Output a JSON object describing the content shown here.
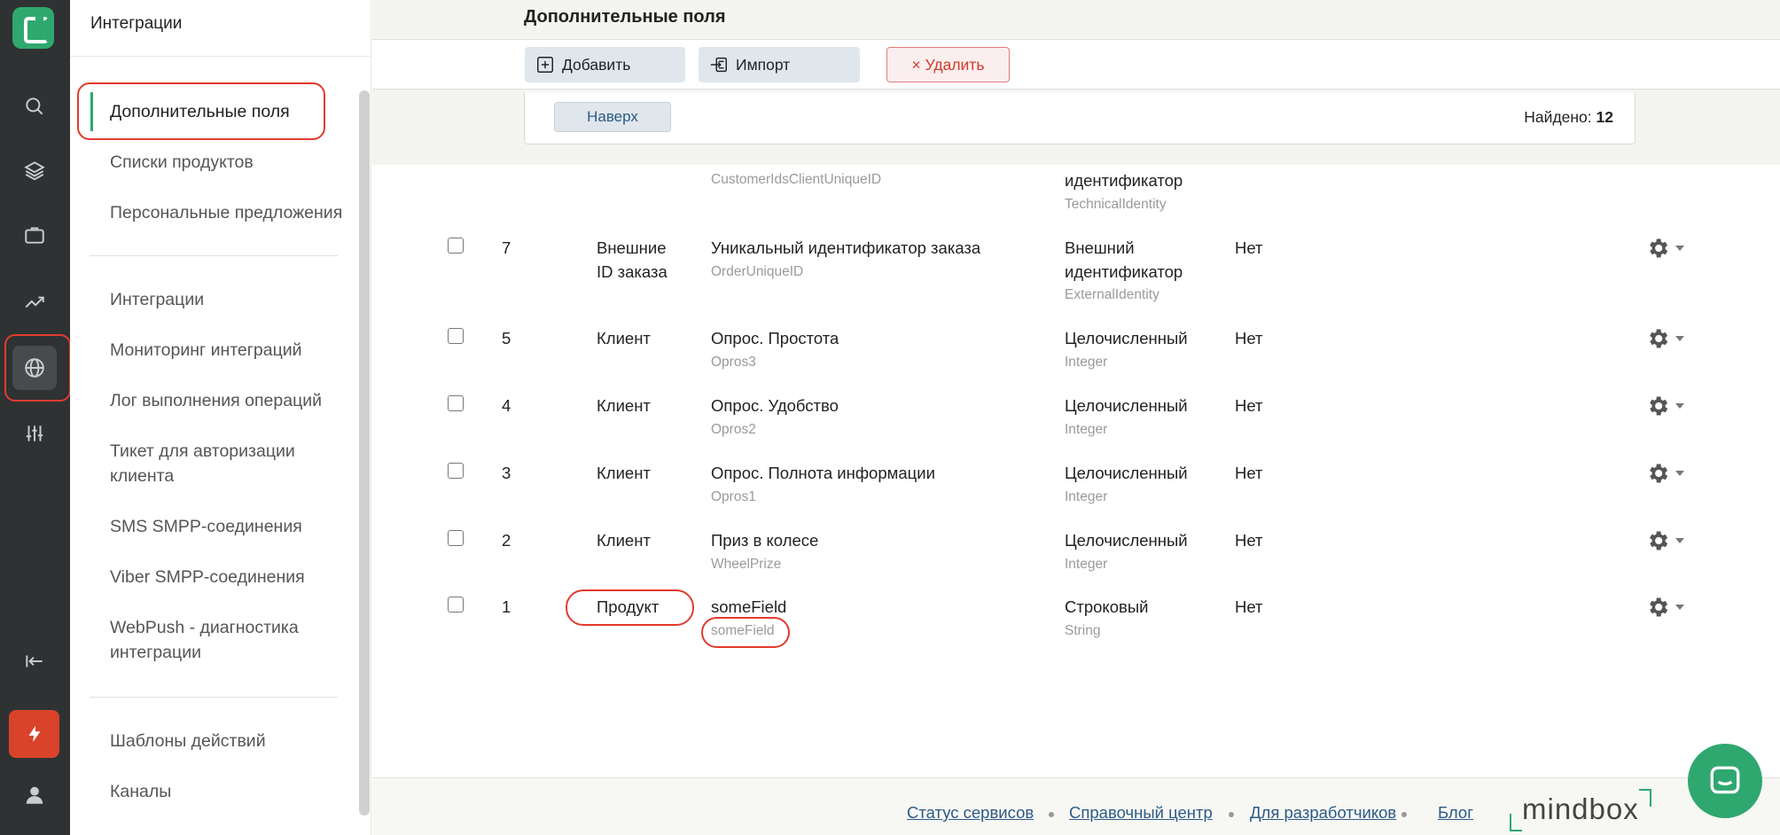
{
  "sidebar": {
    "header": "Интеграции",
    "items": [
      {
        "label": "Дополнительные поля"
      },
      {
        "label": "Списки продуктов"
      },
      {
        "label": "Персональные предложения"
      },
      {
        "label": "Интеграции"
      },
      {
        "label": "Мониторинг интеграций"
      },
      {
        "label": "Лог выполнения операций"
      },
      {
        "label": "Тикет для авторизации клиента"
      },
      {
        "label": "SMS SMPP-соединения"
      },
      {
        "label": "Viber SMPP-соединения"
      },
      {
        "label": "WebPush - диагностика интеграции"
      },
      {
        "label": "Шаблоны действий"
      },
      {
        "label": "Каналы"
      }
    ]
  },
  "rail": {
    "icons": [
      "search-icon",
      "layers-icon",
      "briefcase-icon",
      "trend-icon",
      "globe-icon",
      "sliders-icon",
      "collapse-icon",
      "bolt-icon",
      "user-icon"
    ]
  },
  "header": {
    "title": "Дополнительные поля",
    "add_label": "Добавить",
    "import_label": "Импорт",
    "delete_label": "× Удалить",
    "up_label": "Наверх",
    "found_label": "Найдено:",
    "found_count": "12"
  },
  "table": {
    "partial_row": {
      "name_sub": "CustomerIdsClientUniqueID",
      "type": "идентификатор",
      "type_sub": "TechnicalIdentity"
    },
    "rows": [
      {
        "id": "7",
        "entity": "Внешние ID заказа",
        "name": "Уникальный идентификатор заказа",
        "system": "OrderUniqueID",
        "type": "Внешний идентификатор",
        "type_sub": "ExternalIdentity",
        "multi": "Нет"
      },
      {
        "id": "5",
        "entity": "Клиент",
        "name": "Опрос. Простота",
        "system": "Opros3",
        "type": "Целочисленный",
        "type_sub": "Integer",
        "multi": "Нет"
      },
      {
        "id": "4",
        "entity": "Клиент",
        "name": "Опрос. Удобство",
        "system": "Opros2",
        "type": "Целочисленный",
        "type_sub": "Integer",
        "multi": "Нет"
      },
      {
        "id": "3",
        "entity": "Клиент",
        "name": "Опрос. Полнота информации",
        "system": "Opros1",
        "type": "Целочисленный",
        "type_sub": "Integer",
        "multi": "Нет"
      },
      {
        "id": "2",
        "entity": "Клиент",
        "name": "Приз в колесе",
        "system": "WheelPrize",
        "type": "Целочисленный",
        "type_sub": "Integer",
        "multi": "Нет"
      },
      {
        "id": "1",
        "entity": "Продукт",
        "name": "someField",
        "system": "someField",
        "type": "Строковый",
        "type_sub": "String",
        "multi": "Нет"
      }
    ]
  },
  "footer": {
    "links": [
      "Статус сервисов",
      "Справочный центр",
      "Для разработчиков",
      "Блог"
    ],
    "brand": "mindbox"
  },
  "colors": {
    "accent": "#2fa86f",
    "highlight": "#e23b2e",
    "rail_bg": "#2f3233",
    "link": "#2d5a86"
  }
}
